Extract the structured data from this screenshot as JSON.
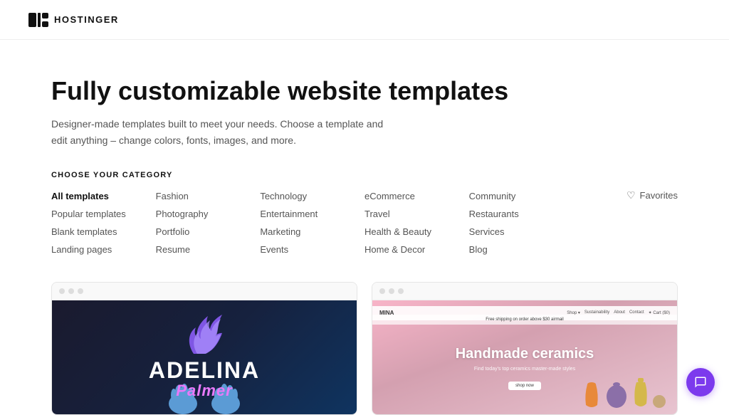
{
  "header": {
    "logo_text": "HOSTINGER"
  },
  "hero": {
    "title": "Fully customizable website templates",
    "subtitle": "Designer-made templates built to meet your needs. Choose a template and edit anything – change colors, fonts, images, and more."
  },
  "categories": {
    "section_label": "CHOOSE YOUR CATEGORY",
    "favorites_label": "Favorites",
    "columns": [
      {
        "items": [
          {
            "label": "All templates",
            "active": true
          },
          {
            "label": "Popular templates",
            "active": false
          },
          {
            "label": "Blank templates",
            "active": false
          },
          {
            "label": "Landing pages",
            "active": false
          }
        ]
      },
      {
        "items": [
          {
            "label": "Fashion",
            "active": false
          },
          {
            "label": "Photography",
            "active": false
          },
          {
            "label": "Portfolio",
            "active": false
          },
          {
            "label": "Resume",
            "active": false
          }
        ]
      },
      {
        "items": [
          {
            "label": "Technology",
            "active": false
          },
          {
            "label": "Entertainment",
            "active": false
          },
          {
            "label": "Marketing",
            "active": false
          },
          {
            "label": "Events",
            "active": false
          }
        ]
      },
      {
        "items": [
          {
            "label": "eCommerce",
            "active": false
          },
          {
            "label": "Travel",
            "active": false
          },
          {
            "label": "Health & Beauty",
            "active": false
          },
          {
            "label": "Home & Decor",
            "active": false
          }
        ]
      },
      {
        "items": [
          {
            "label": "Community",
            "active": false
          },
          {
            "label": "Restaurants",
            "active": false
          },
          {
            "label": "Services",
            "active": false
          },
          {
            "label": "Blog",
            "active": false
          }
        ]
      }
    ]
  },
  "templates": {
    "card1": {
      "name": "ADELINA",
      "subname": "Palmer",
      "theme": "dark"
    },
    "card2": {
      "title": "Handmade ceramics",
      "subtitle": "Find today's top ceramics master-made styles",
      "cta": "shop now",
      "nav_logo": "MINA",
      "nav_links": [
        "Shop ▾",
        "Sustainability",
        "About",
        "Contact",
        "Cart ($0)"
      ]
    }
  }
}
